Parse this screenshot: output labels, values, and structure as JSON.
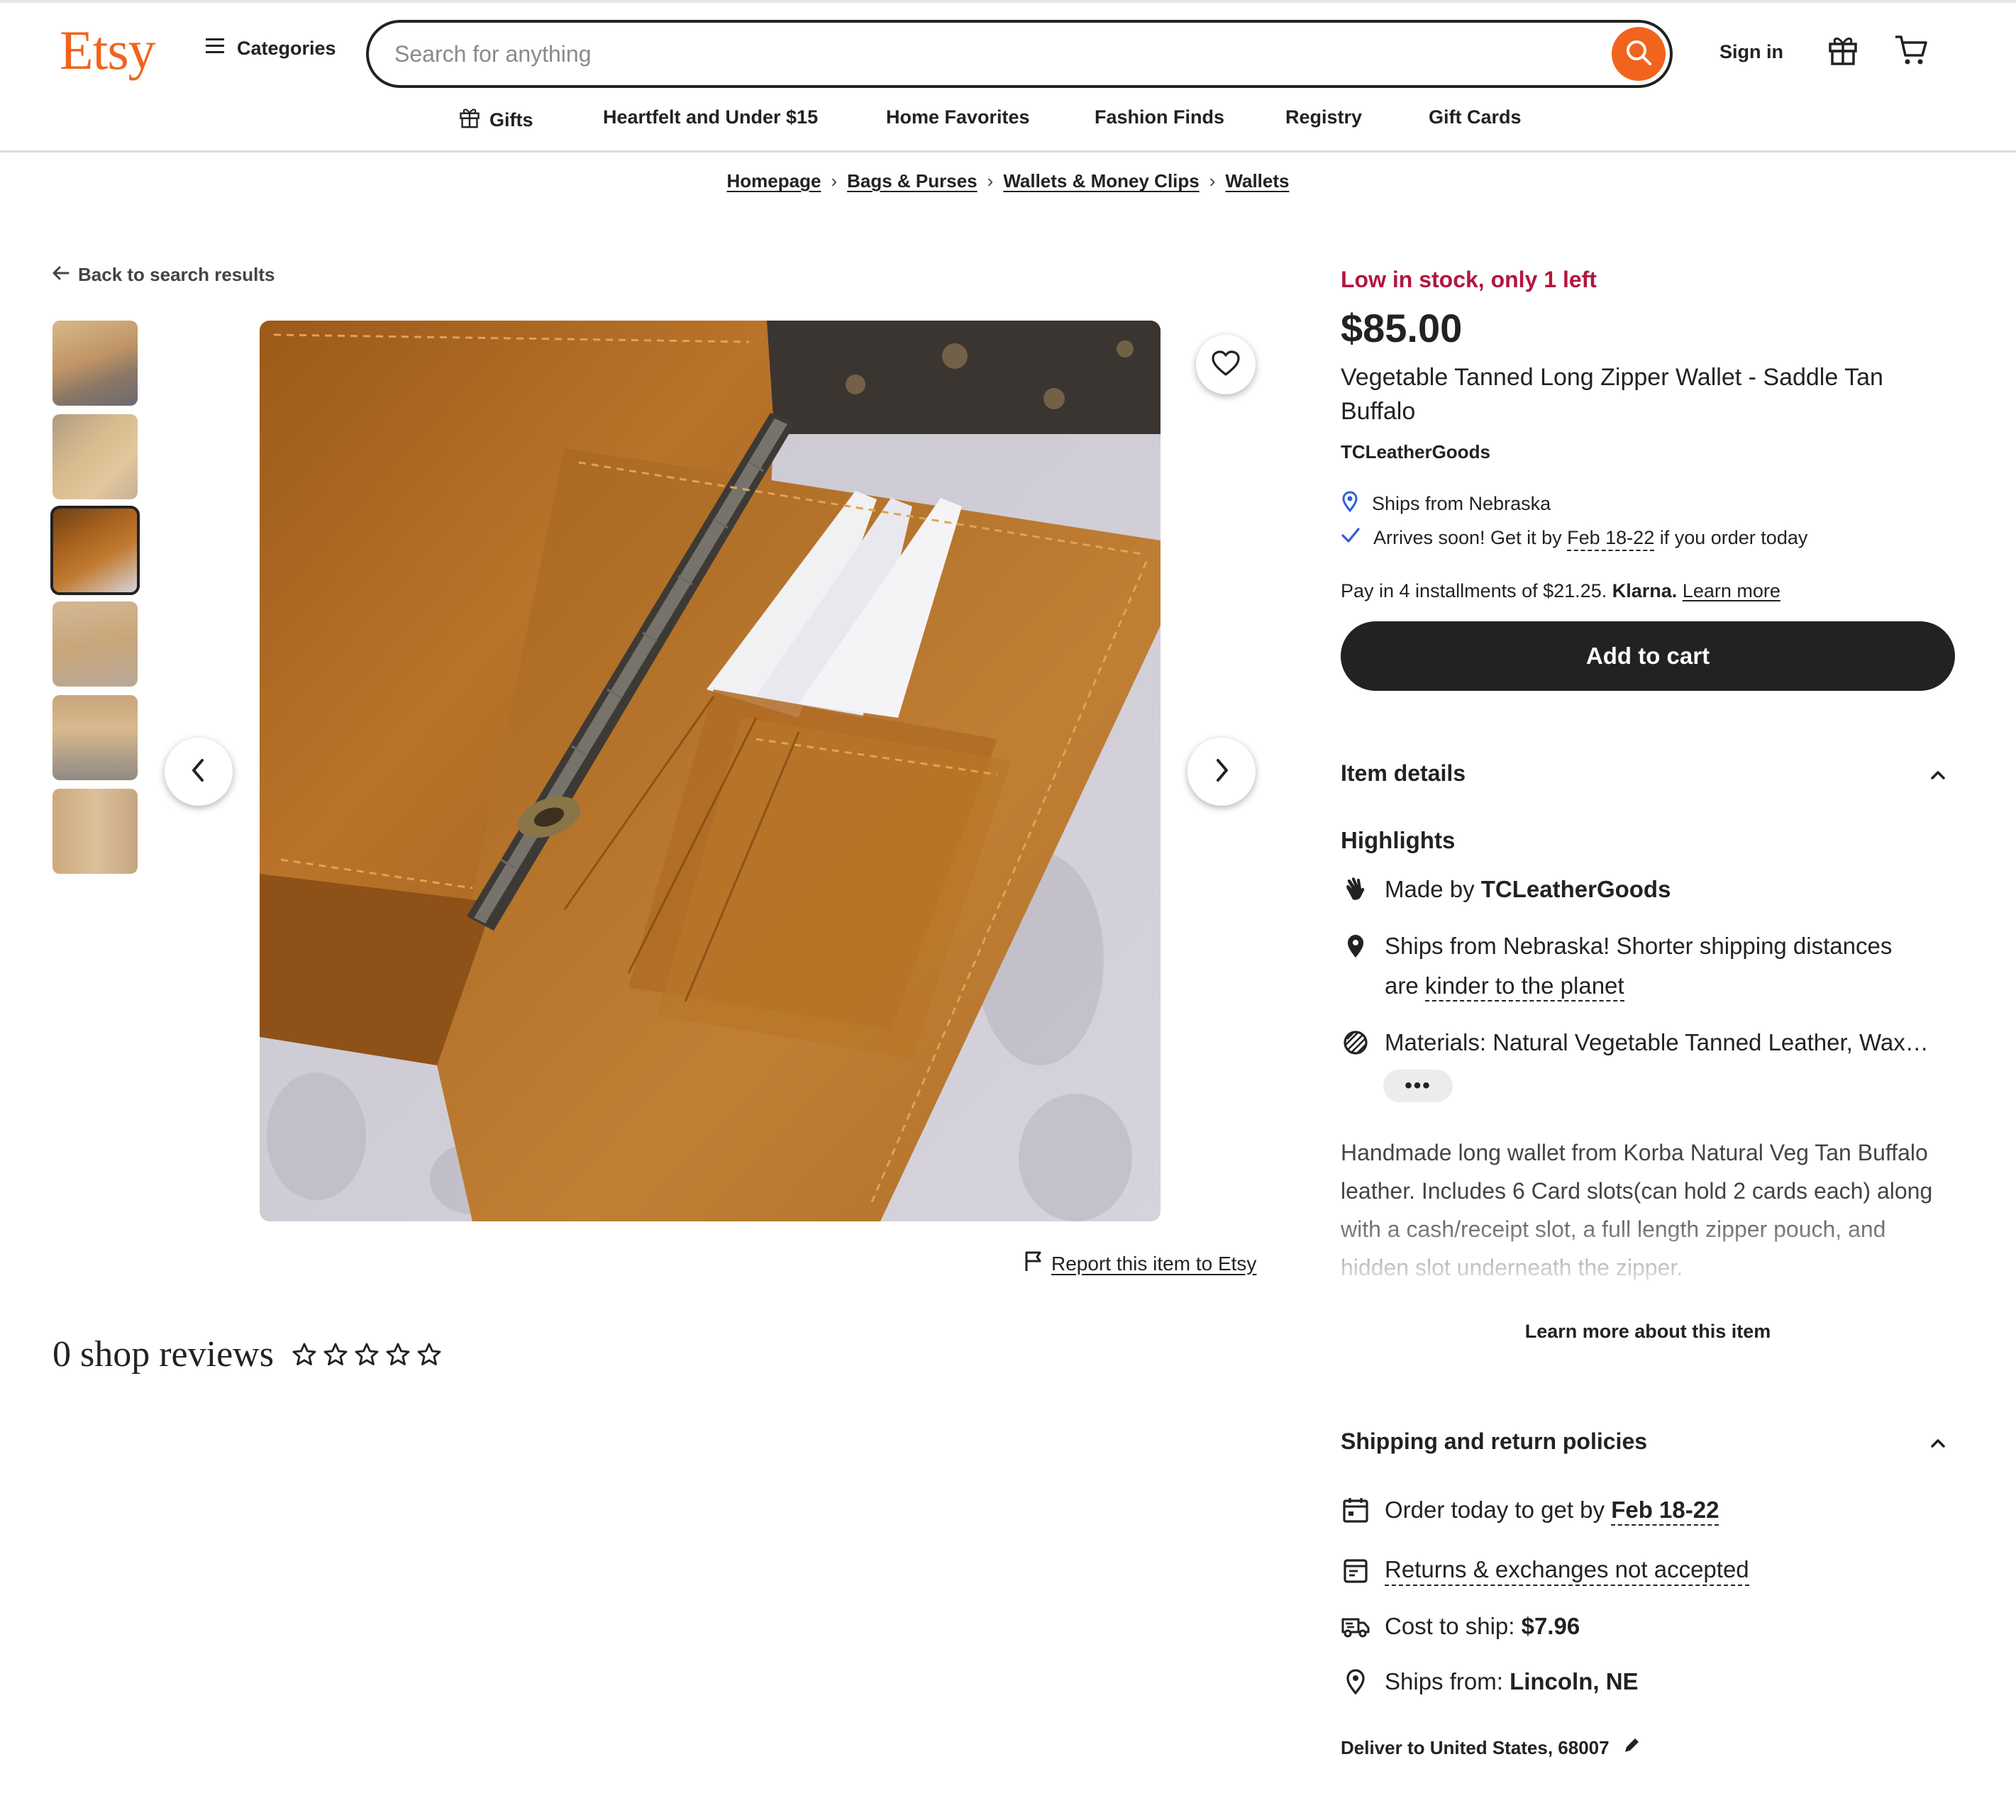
{
  "header": {
    "logo": "Etsy",
    "categories_label": "Categories",
    "search_placeholder": "Search for anything",
    "sign_in": "Sign in"
  },
  "nav": [
    {
      "label": "Gifts"
    },
    {
      "label": "Heartfelt and Under $15"
    },
    {
      "label": "Home Favorites"
    },
    {
      "label": "Fashion Finds"
    },
    {
      "label": "Registry"
    },
    {
      "label": "Gift Cards"
    }
  ],
  "breadcrumb": [
    "Homepage",
    "Bags & Purses",
    "Wallets & Money Clips",
    "Wallets"
  ],
  "gallery": {
    "back_label": "Back to search results",
    "thumbnail_count": 6,
    "selected_index": 3,
    "report_label": "Report this item to Etsy"
  },
  "reviews": {
    "label": "0 shop reviews",
    "rating": 0,
    "max": 5
  },
  "product": {
    "stock": "Low in stock, only 1 left",
    "price": "$85.00",
    "title": "Vegetable Tanned Long Zipper Wallet - Saddle Tan Buffalo",
    "shop": "TCLeatherGoods",
    "ships_from": "Ships from Nebraska",
    "arrives_pre": "Arrives soon! Get it by",
    "arrives_date": "Feb 18-22",
    "arrives_post": "if you order today",
    "klarna_text": "Pay in 4 installments of $21.25.",
    "klarna_brand": "Klarna.",
    "klarna_link": "Learn more",
    "add_to_cart": "Add to cart"
  },
  "details": {
    "heading": "Item details",
    "highlights_heading": "Highlights",
    "made_by_pre": "Made by",
    "made_by_shop": "TCLeatherGoods",
    "ships_line1": "Ships from Nebraska! Shorter shipping distances",
    "ships_line2_pre": "are",
    "ships_line2_link": "kinder to the planet",
    "materials": "Materials: Natural Vegetable Tanned Leather, Wax…",
    "more_label": "•••",
    "description": "Handmade long wallet from Korba Natural Veg Tan Buffalo leather. Includes 6 Card slots(can hold 2 cards each) along with a cash/receipt slot, a full length zipper pouch, and hidden slot underneath the zipper.",
    "learn_more": "Learn more about this item"
  },
  "shipping": {
    "heading": "Shipping and return policies",
    "order_pre": "Order today to get by",
    "order_date": "Feb 18-22",
    "returns": "Returns & exchanges not accepted",
    "cost_label": "Cost to ship:",
    "cost_value": "$7.96",
    "from_label": "Ships from:",
    "from_value": "Lincoln, NE",
    "deliver": "Deliver to United States, 68007"
  },
  "colors": {
    "brand": "#f1641e",
    "stock_alert": "#b1173f",
    "button_dark": "#222222",
    "ships_icon": "#2f5fd4"
  }
}
